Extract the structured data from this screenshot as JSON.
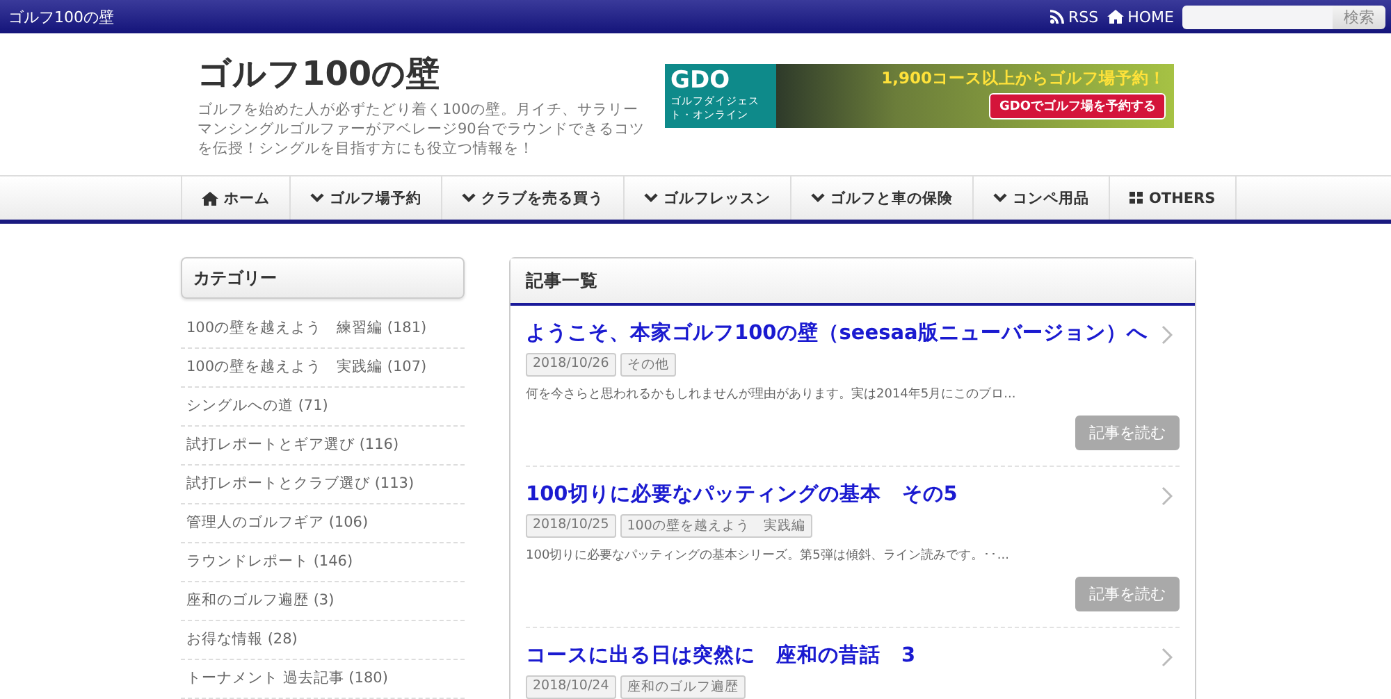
{
  "topbar": {
    "site_name": "ゴルフ100の壁",
    "links": [
      {
        "kind": "rss",
        "label": "RSS"
      },
      {
        "kind": "home",
        "label": "HOME"
      }
    ],
    "search": {
      "button": "検索"
    }
  },
  "header": {
    "title": "ゴルフ100の壁",
    "description": "ゴルフを始めた人が必ずたどり着く100の壁。月イチ、サラリーマンシングルゴルファーがアベレージ90台でラウンドできるコツを伝授！シングルを目指す方にも役立つ情報を！",
    "banner": {
      "logo": "GDO",
      "logo_caption": "ゴルフダイジェスト・オンライン",
      "headline": "1,900コース以上からゴルフ場予約！",
      "button": "GDOでゴルフ場を予約する"
    }
  },
  "nav": [
    {
      "kind": "home",
      "label": "ホーム"
    },
    {
      "kind": "dropdown",
      "label": "ゴルフ場予約"
    },
    {
      "kind": "dropdown",
      "label": "クラブを売る買う"
    },
    {
      "kind": "dropdown",
      "label": "ゴルフレッスン"
    },
    {
      "kind": "dropdown",
      "label": "ゴルフと車の保険"
    },
    {
      "kind": "dropdown",
      "label": "コンペ用品"
    },
    {
      "kind": "grid",
      "label": "OTHERS"
    }
  ],
  "sidebar": {
    "title": "カテゴリー",
    "items": [
      "100の壁を越えよう　練習編 (181)",
      "100の壁を越えよう　実践編 (107)",
      "シングルへの道 (71)",
      "試打レポートとギア選び (116)",
      "試打レポートとクラブ選び (113)",
      "管理人のゴルフギア (106)",
      "ラウンドレポート (146)",
      "座和のゴルフ遍歴 (3)",
      "お得な情報 (28)",
      "トーナメント 過去記事 (180)"
    ]
  },
  "articles": {
    "title": "記事一覧",
    "items": [
      {
        "title": "ようこそ、本家ゴルフ100の壁（seesaa版ニューバージョン）へ",
        "date": "2018/10/26",
        "category": "その他",
        "excerpt": "何を今さらと思われるかもしれませんが理由があります。実は2014年5月にこのブロ...",
        "button": "記事を読む"
      },
      {
        "title": "100切りに必要なパッティングの基本　その5",
        "date": "2018/10/25",
        "category": "100の壁を越えよう　実践編",
        "excerpt": "100切りに必要なパッティングの基本シリーズ。第5弾は傾斜、ライン読みです。･･...",
        "button": "記事を読む"
      },
      {
        "title": "コースに出る日は突然に　座和の昔話　3",
        "date": "2018/10/24",
        "category": "座和のゴルフ遍歴"
      }
    ]
  }
}
